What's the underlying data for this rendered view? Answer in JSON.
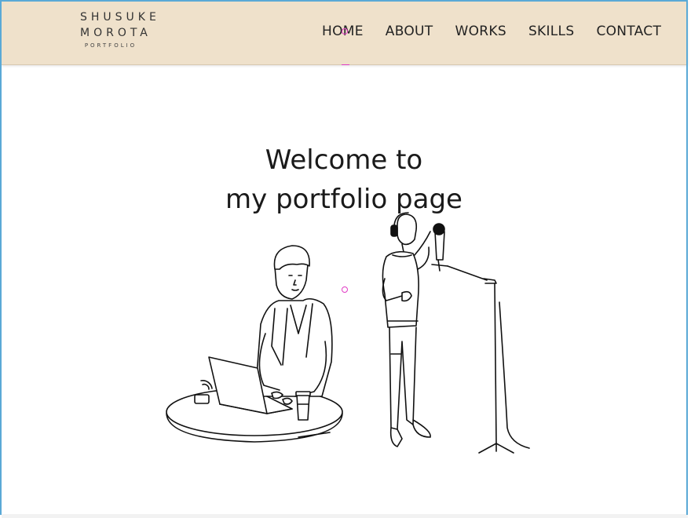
{
  "brand": {
    "line1": "SHUSUKE",
    "line2": "MOROTA",
    "line3": "PORTFOLIO"
  },
  "nav": {
    "items": [
      "HOME",
      "ABOUT",
      "WORKS",
      "SKILLS",
      "CONTACT"
    ]
  },
  "hero": {
    "title_line1": "Welcome to",
    "title_line2": "my portfolio page"
  },
  "colors": {
    "header_bg": "#efe1cb",
    "marker": "#e13cc5",
    "frame": "#5aa9d6"
  }
}
